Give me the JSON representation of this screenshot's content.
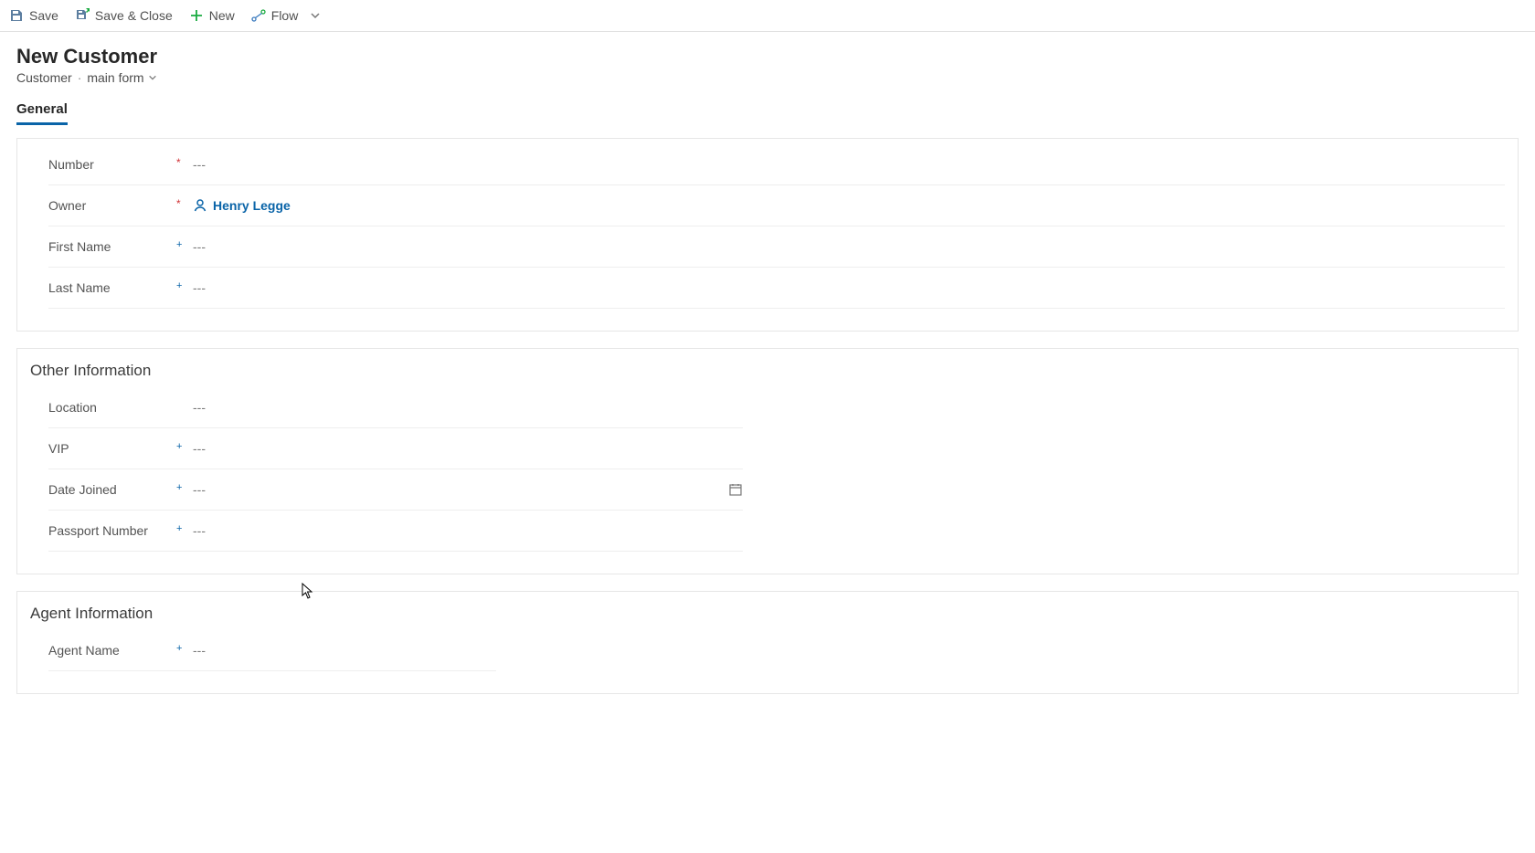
{
  "commands": {
    "save": "Save",
    "save_close": "Save & Close",
    "new": "New",
    "flow": "Flow"
  },
  "header": {
    "title": "New Customer",
    "entity": "Customer",
    "form_name": "main form"
  },
  "tabs": {
    "general": "General"
  },
  "placeholders": {
    "empty": "---"
  },
  "sections": {
    "primary": {
      "fields": {
        "number": {
          "label": "Number",
          "value": "---",
          "req": "required"
        },
        "owner": {
          "label": "Owner",
          "value": "Henry Legge",
          "req": "required",
          "type": "lookup"
        },
        "first_name": {
          "label": "First Name",
          "value": "---",
          "req": "recommended"
        },
        "last_name": {
          "label": "Last Name",
          "value": "---",
          "req": "recommended"
        }
      }
    },
    "other": {
      "title": "Other Information",
      "fields": {
        "location": {
          "label": "Location",
          "value": "---",
          "req": ""
        },
        "vip": {
          "label": "VIP",
          "value": "---",
          "req": "recommended"
        },
        "date_joined": {
          "label": "Date Joined",
          "value": "---",
          "req": "recommended",
          "type": "date"
        },
        "passport": {
          "label": "Passport Number",
          "value": "---",
          "req": "recommended"
        }
      }
    },
    "agent": {
      "title": "Agent Information",
      "fields": {
        "agent_name": {
          "label": "Agent Name",
          "value": "---",
          "req": "recommended"
        }
      }
    }
  }
}
